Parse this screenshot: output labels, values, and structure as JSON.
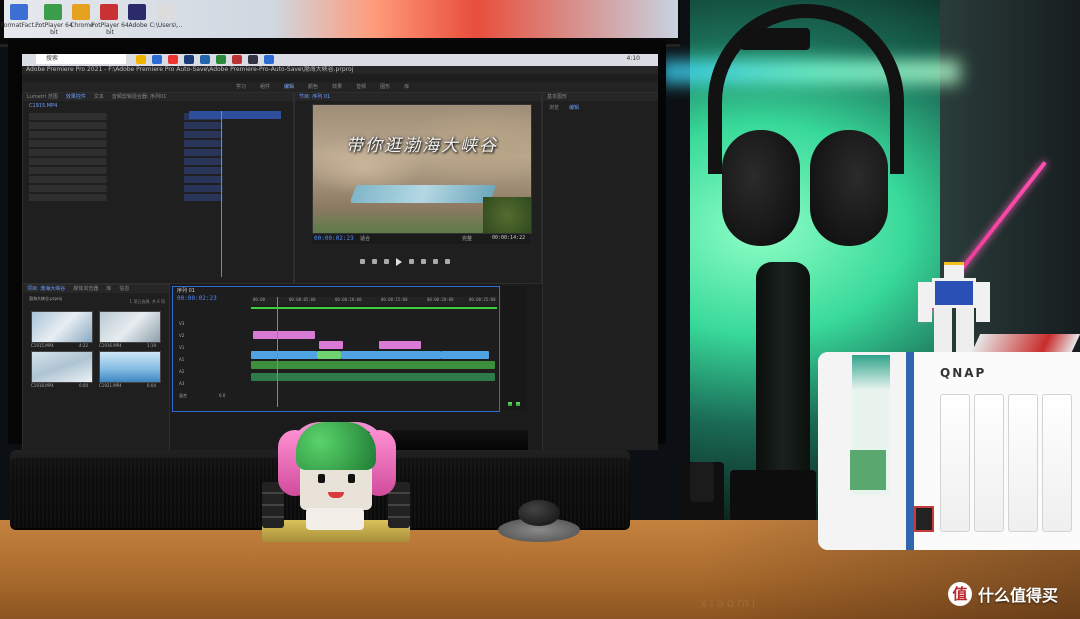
{
  "top_monitor": {
    "desktop_icons": [
      {
        "label": "FormatFact..."
      },
      {
        "label": "PotPlayer 64 bit"
      },
      {
        "label": "Chrome"
      },
      {
        "label": "PotPlayer 64 bit"
      },
      {
        "label": "Adobe"
      },
      {
        "label": "C:\\Users\\..."
      }
    ]
  },
  "taskbar": {
    "search_text": "搜索",
    "clock": "4:10"
  },
  "premiere": {
    "title": "Adobe Premiere Pro 2021 - F:\\Adobe Premiere Pro Auto-Save\\Adobe Premiere-Pro-Auto-Save\\渤海大峡谷.prproj",
    "workspace_tabs": [
      "学习",
      "组件",
      "编辑",
      "颜色",
      "效果",
      "音频",
      "图形",
      "库"
    ],
    "active_workspace": "编辑",
    "left_panel_tabs": [
      "Lumetri 范围",
      "效果控件",
      "文本",
      "音频剪辑混合器: 序列01"
    ],
    "source_clip": "C1915.MP4",
    "program_tabs": [
      "节目: 序列 01"
    ],
    "right_panel_tabs": [
      "基本图形"
    ],
    "right_panel_subtabs": [
      "浏览",
      "编辑"
    ],
    "video_caption": "带你逛渤海大峡谷",
    "program_timecode_left": "00:00:02:23",
    "program_fit": "适合",
    "program_quality": "完整",
    "program_timecode_right": "00:00:14:22",
    "project_panel_tabs": [
      "项目: 渤海大峡谷",
      "媒体浏览器",
      "库",
      "信息"
    ],
    "project_name": "渤海大峡谷.prproj",
    "project_item_count": "1 项已选择, 共 6 项",
    "clips": [
      {
        "name": "C1915.MP4",
        "duration": "4:22"
      },
      {
        "name": "C1916.MP4",
        "duration": "1:19"
      },
      {
        "name": "C1918.MP4",
        "duration": "0:00"
      },
      {
        "name": "C1921.MP4",
        "duration": "6:04"
      }
    ],
    "timeline_tab": "序列 01",
    "timeline_timecode": "00:00:02:23",
    "ruler_marks": [
      "00:00",
      "00:00:05:00",
      "00:00:10:00",
      "00:00:15:00",
      "00:00:20:00",
      "00:00:25:00"
    ],
    "track_labels": [
      "V3",
      "V2",
      "V1",
      "A1",
      "A2",
      "A3",
      "混合"
    ],
    "master_value": "0.0"
  },
  "nas": {
    "brand": "QNAP"
  },
  "desk": {
    "mat_logo": "xiaomi"
  },
  "watermark": {
    "icon": "值",
    "text": "什么值得买"
  },
  "colors": {
    "premiere_accent": "#4f8cff",
    "led_glow": "#38d99a",
    "nas_accent": "#2f66ad",
    "watermark_red": "#b7242a"
  }
}
